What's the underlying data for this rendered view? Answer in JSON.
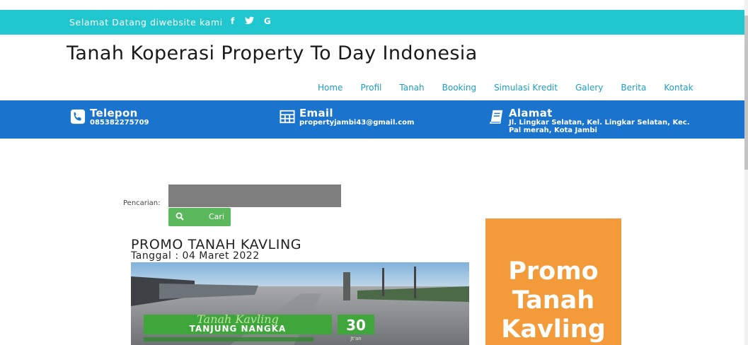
{
  "topbar": {
    "welcome": "Selamat Datang diwebsite kami",
    "social": [
      "f",
      "✦",
      "G"
    ]
  },
  "site": {
    "title": "Tanah Koperasi Property To Day Indonesia"
  },
  "nav": {
    "items": [
      "Home",
      "Profil",
      "Tanah",
      "Booking",
      "Simulasi Kredit",
      "Galery",
      "Berita",
      "Kontak"
    ]
  },
  "contact": {
    "telepon": {
      "title": "Telepon",
      "value": "085382275709"
    },
    "email": {
      "title": "Email",
      "value": "propertyjambi43@gmail.com"
    },
    "alamat": {
      "title": "Alamat",
      "value": "Jl. Lingkar Selatan, Kel. Lingkar Selatan, Kec. Pal merah, Kota Jambi"
    }
  },
  "search": {
    "label": "Pencarian:",
    "value": "",
    "button_label": "Cari"
  },
  "promo": {
    "title": "PROMO TANAH KAVLING",
    "date": "Tanggal : 04 Maret 2022",
    "image_text": {
      "script": "Tanah Kavling",
      "name": "TANJUNG NANGKA",
      "price": "30",
      "unit": "Jt'an"
    }
  },
  "side_banner": {
    "lines": [
      "Promo",
      "Tanah",
      "Kavling"
    ]
  },
  "colors": {
    "topbar": "#21c7cf",
    "infobar": "#1a73cc",
    "nav_link": "#1aa0c4",
    "button": "#5cb85c",
    "banner": "#f39a3a"
  }
}
